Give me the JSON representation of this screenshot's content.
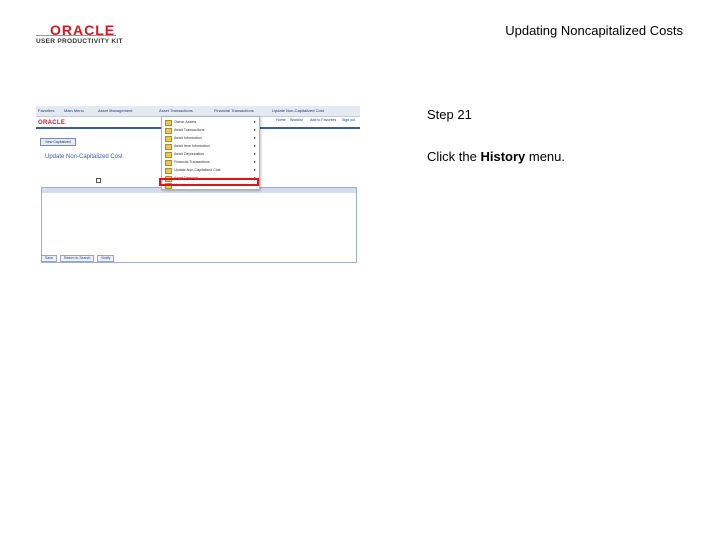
{
  "logo": {
    "brand": "ORACLE",
    "subtitle": "USER PRODUCTIVITY KIT"
  },
  "document": {
    "title": "Updating Noncapitalized Costs"
  },
  "step": {
    "label": "Step 21"
  },
  "instruction": {
    "before": "Click the ",
    "target": "History",
    "after": " menu."
  },
  "screenshot": {
    "nav": [
      "Favorites",
      "Main Menu",
      "Asset Management",
      "Asset Transactions",
      "Financial Transactions",
      "Update Non-Capitalized Cost"
    ],
    "brand": "ORACLE",
    "toplinks": [
      "Home",
      "Worklist",
      "Add to Favorites",
      "Sign out"
    ],
    "tab_button": "New Capitalized",
    "page_title": "Update Non-Capitalized Cost",
    "menu_items": [
      "Owner Assets",
      "Asset Transactions",
      "Asset Information",
      "Asset Item Information",
      "Asset Depreciation",
      "Financial Transactions",
      "Update Non-Capitalized Cost",
      "Asset Disposal",
      "History"
    ],
    "bottom_buttons": [
      "Save",
      "Return to Search",
      "Notify"
    ]
  }
}
